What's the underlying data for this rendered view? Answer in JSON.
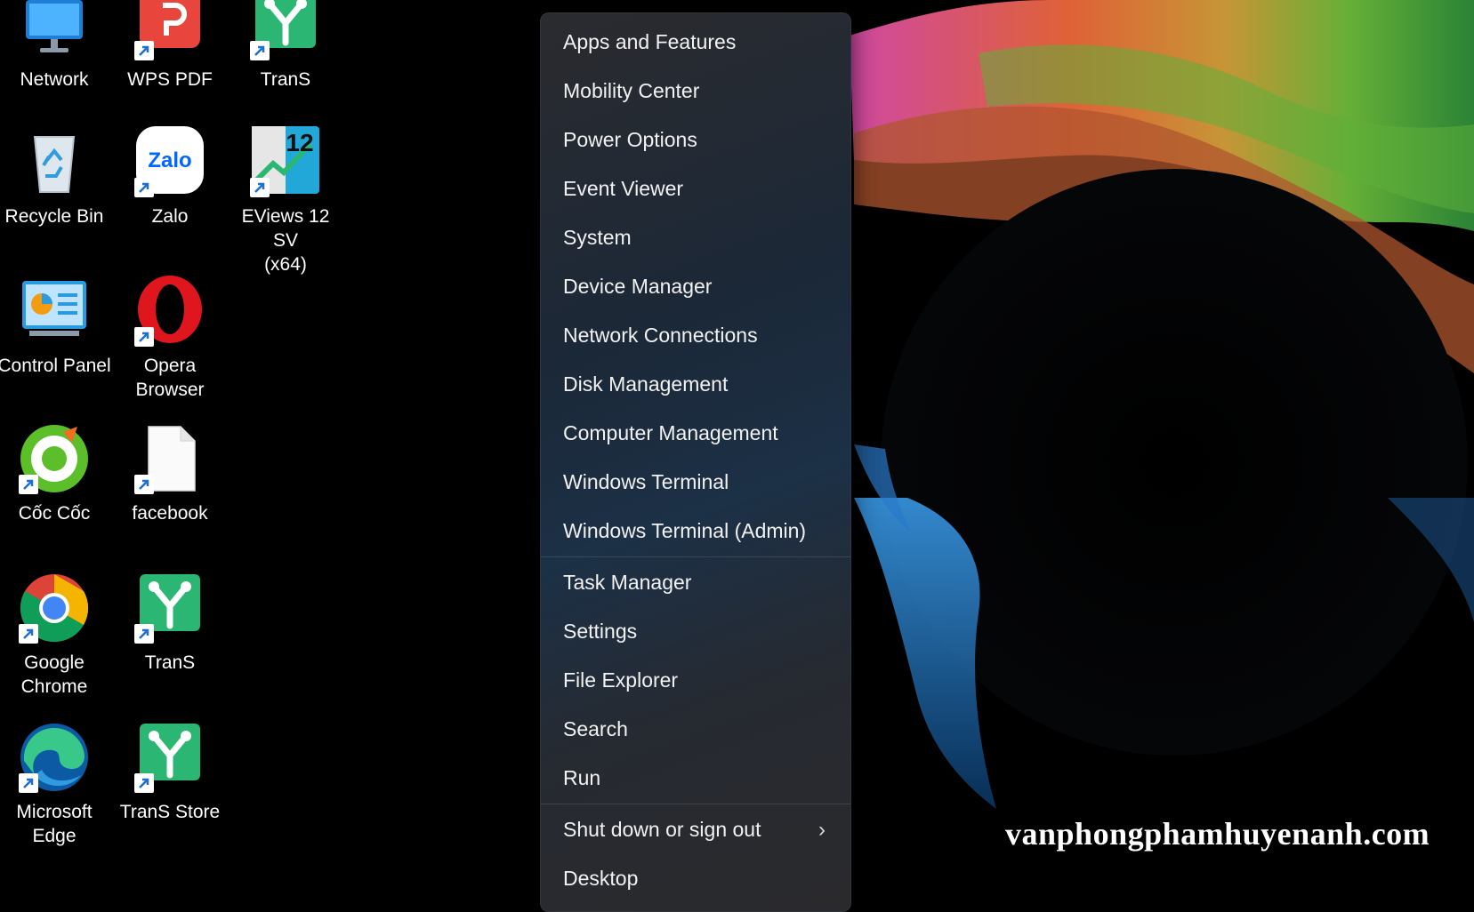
{
  "desktop": {
    "icons": [
      {
        "label": "Network",
        "icon": "network-icon"
      },
      {
        "label": "WPS PDF",
        "icon": "wps-pdf-icon"
      },
      {
        "label": "TranS",
        "icon": "trans-icon"
      },
      {
        "label": "Recycle Bin",
        "icon": "recycle-bin-icon"
      },
      {
        "label": "Zalo",
        "icon": "zalo-icon",
        "glyph": "Zalo"
      },
      {
        "label": "EViews 12 SV\n(x64)",
        "icon": "eviews-icon",
        "glyph": "12"
      },
      {
        "label": "Control Panel",
        "icon": "control-panel-icon"
      },
      {
        "label": "Opera\nBrowser",
        "icon": "opera-icon"
      },
      {
        "label": "Cốc Cốc",
        "icon": "coccoc-icon"
      },
      {
        "label": "facebook",
        "icon": "file-icon"
      },
      {
        "label": "Google\nChrome",
        "icon": "chrome-icon"
      },
      {
        "label": "TranS",
        "icon": "trans-icon"
      },
      {
        "label": "Microsoft\nEdge",
        "icon": "edge-icon"
      },
      {
        "label": "TranS Store",
        "icon": "trans-store-icon"
      }
    ]
  },
  "menu": {
    "group1": [
      "Apps and Features",
      "Mobility Center",
      "Power Options",
      "Event Viewer",
      "System",
      "Device Manager",
      "Network Connections",
      "Disk Management",
      "Computer Management",
      "Windows Terminal",
      "Windows Terminal (Admin)"
    ],
    "group2": [
      "Task Manager",
      "Settings",
      "File Explorer",
      "Search",
      "Run"
    ],
    "group3": [
      "Shut down or sign out",
      "Desktop"
    ],
    "submenu_chevron": "›"
  },
  "watermark": "vanphongphamhuyenanh.com",
  "colors": {
    "menu_bg": "#1c2a3a",
    "accent_blue": "#1e88e5",
    "trans_green": "#2bb673"
  }
}
